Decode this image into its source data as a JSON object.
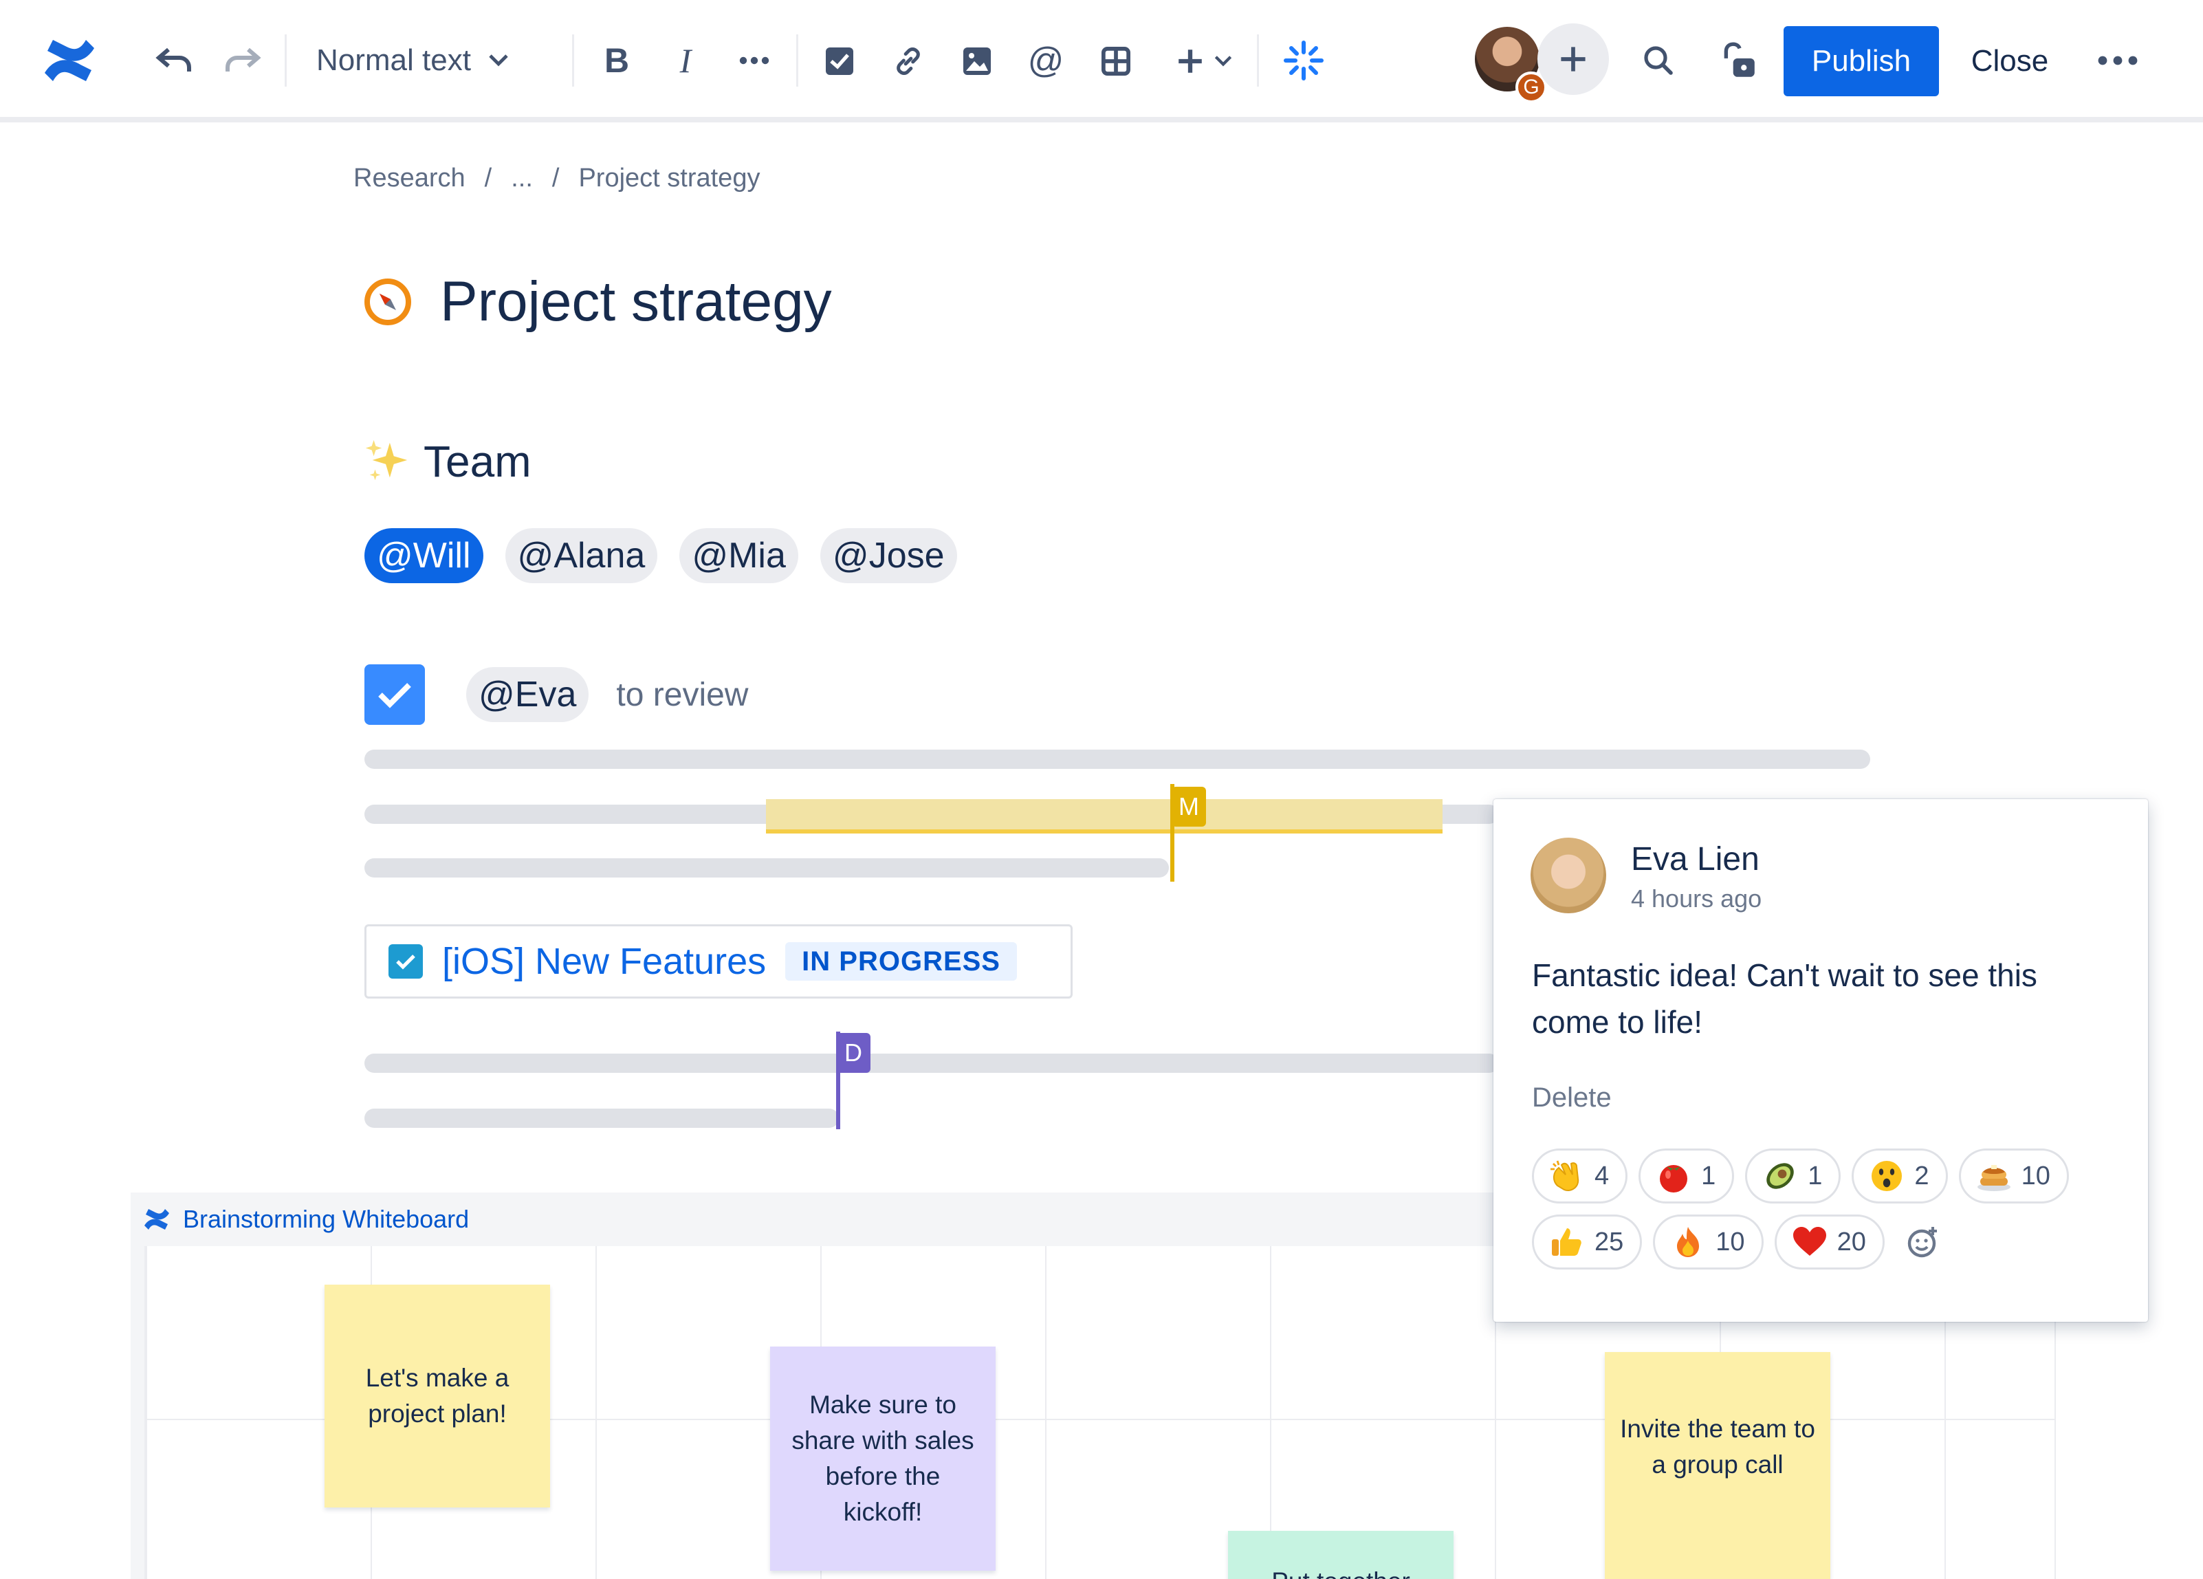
{
  "toolbar": {
    "text_style": "Normal text",
    "publish_label": "Publish",
    "close_label": "Close",
    "collaborator_badge": "G"
  },
  "breadcrumb": {
    "root": "Research",
    "ellipsis": "...",
    "current": "Project strategy"
  },
  "page": {
    "title": "Project strategy"
  },
  "team": {
    "heading": "Team",
    "mentions": [
      "@Will",
      "@Alana",
      "@Mia",
      "@Jose"
    ]
  },
  "task": {
    "assignee": "@Eva",
    "text": "to review"
  },
  "cursors": {
    "m_label": "M",
    "d_label": "D"
  },
  "jira": {
    "title": "[iOS] New Features",
    "status": "IN PROGRESS"
  },
  "whiteboard": {
    "title": "Brainstorming Whiteboard",
    "notes": [
      {
        "text": "Let's make a project plan!",
        "color": "#fdf0a9"
      },
      {
        "text": "Make sure to share with sales before the kickoff!",
        "color": "#dfd8fd"
      },
      {
        "text": "Put together",
        "color": "#c6f3e1"
      },
      {
        "text": "Invite the team to a group call",
        "color": "#fdf0a9"
      }
    ]
  },
  "comment": {
    "author": "Eva Lien",
    "time": "4 hours ago",
    "body": "Fantastic idea! Can't wait to see this come to life!",
    "delete_label": "Delete",
    "reactions": [
      {
        "icon": "clap-icon",
        "count": "4"
      },
      {
        "icon": "tomato-icon",
        "count": "1"
      },
      {
        "icon": "avocado-icon",
        "count": "1"
      },
      {
        "icon": "surprised-face-icon",
        "count": "2"
      },
      {
        "icon": "pancakes-icon",
        "count": "10"
      },
      {
        "icon": "thumbs-up-icon",
        "count": "25"
      },
      {
        "icon": "fire-icon",
        "count": "10"
      },
      {
        "icon": "heart-icon",
        "count": "20"
      }
    ]
  },
  "colors": {
    "brand": "#0c66e4",
    "highlight": "#f5cd47",
    "cursor_m": "#e2b203",
    "cursor_d": "#6e5dc6"
  }
}
